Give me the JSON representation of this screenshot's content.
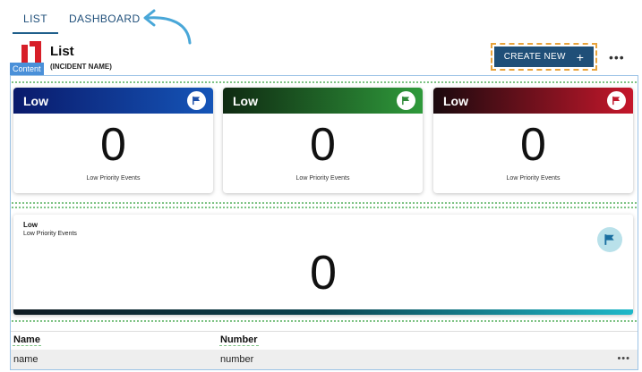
{
  "tabs": [
    {
      "label": "LIST",
      "active": true
    },
    {
      "label": "DASHBOARD",
      "active": false
    }
  ],
  "header": {
    "title": "List",
    "subtitle": "(INCIDENT NAME)",
    "content_tag": "Content",
    "create_label": "CREATE NEW",
    "create_icon": "+",
    "more": "•••"
  },
  "cards": [
    {
      "title": "Low",
      "value": "0",
      "caption": "Low Priority Events",
      "icon": "flag-icon",
      "gradient": [
        "#0a1a6b",
        "#1555b8"
      ],
      "icon_color": "#1c4fa8"
    },
    {
      "title": "Low",
      "value": "0",
      "caption": "Low Priority Events",
      "icon": "flag-icon",
      "gradient": [
        "#0f2a12",
        "#2f9a3b"
      ],
      "icon_color": "#2f8a39"
    },
    {
      "title": "Low",
      "value": "0",
      "caption": "Low Priority Events",
      "icon": "flag-icon",
      "gradient": [
        "#1a0a0e",
        "#c5172b"
      ],
      "icon_color": "#c0192c"
    }
  ],
  "wide_card": {
    "title": "Low",
    "caption": "Low Priority Events",
    "value": "0",
    "icon": "flag-icon",
    "icon_color": "#1a6fa0"
  },
  "table": {
    "columns": [
      "Name",
      "Number"
    ],
    "rows": [
      {
        "name": "name",
        "number": "number",
        "more": "•••"
      }
    ]
  }
}
